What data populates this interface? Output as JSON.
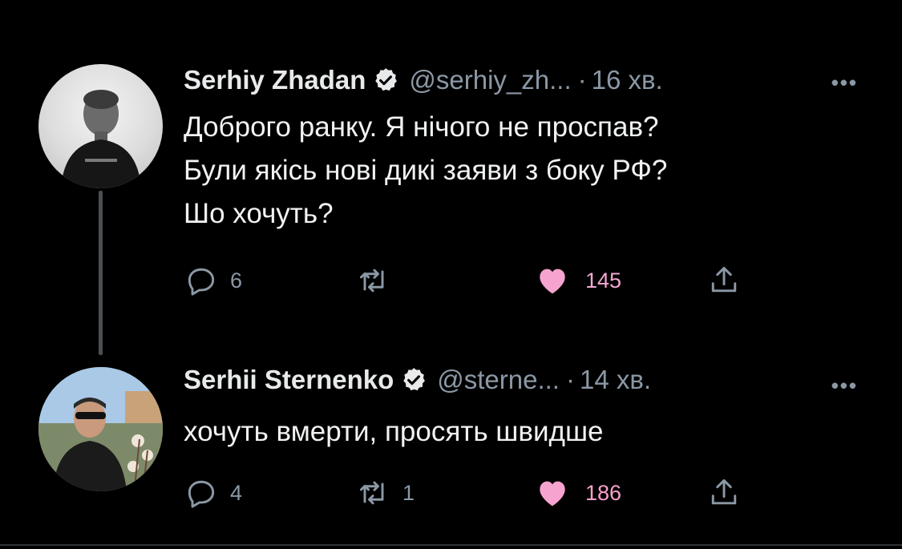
{
  "tweets": [
    {
      "name": "Serhiy Zhadan",
      "handle": "@serhiy_zh...",
      "separator": "·",
      "time": "16 хв.",
      "more": "•••",
      "lines": [
        "Доброго ранку. Я нічого не проспав?",
        "Були якісь нові дикі заяви з боку РФ?",
        "Шо хочуть?"
      ],
      "reply_count": "6",
      "retweet_count": "",
      "like_count": "145",
      "liked": true
    },
    {
      "name": "Serhii Sternenko",
      "handle": "@sterne...",
      "separator": "·",
      "time": "14 хв.",
      "more": "•••",
      "lines": [
        "хочуть вмерти, просять швидше"
      ],
      "reply_count": "4",
      "retweet_count": "1",
      "like_count": "186",
      "liked": true
    }
  ],
  "colors": {
    "background": "#000000",
    "text": "#e7e9ea",
    "secondary": "#8b98a5",
    "like": "#f7a3cf",
    "verified_badge": "#e7e9ea"
  },
  "icons": {
    "reply": "reply-icon",
    "retweet": "retweet-icon",
    "like": "heart-icon",
    "share": "share-icon",
    "verified": "verified-badge-icon",
    "more": "more-icon"
  }
}
